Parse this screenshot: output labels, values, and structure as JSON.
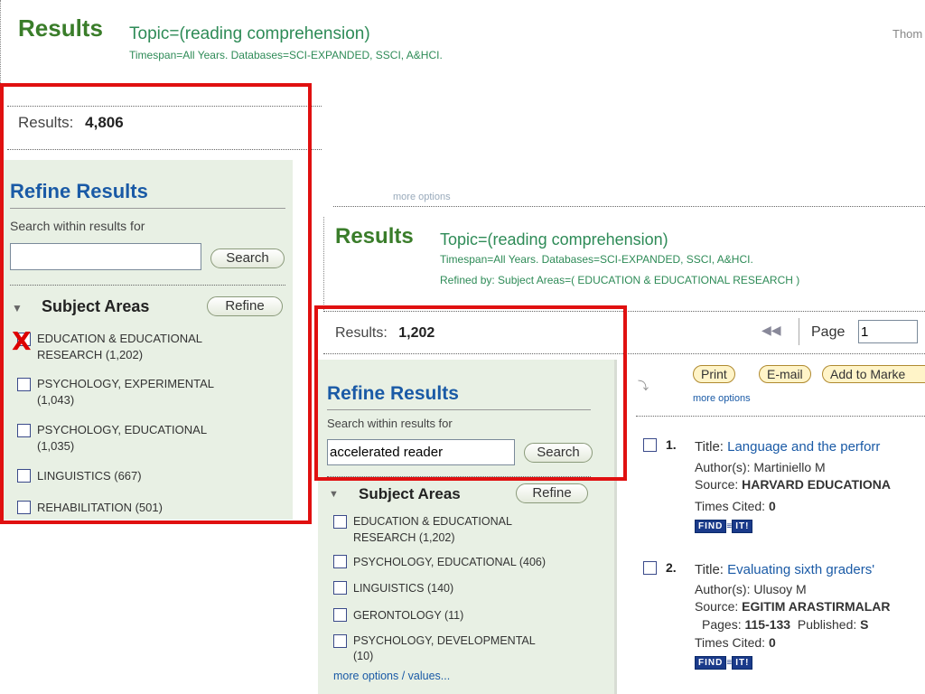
{
  "top": {
    "results_label": "Results",
    "topic": "Topic=(reading comprehension)",
    "timespan": "Timespan=All Years. Databases=SCI-EXPANDED, SSCI, A&HCI.",
    "corner": "Thom Sc"
  },
  "left_panel": {
    "results_label": "Results:",
    "results_count": "4,806",
    "refine_title": "Refine Results",
    "search_label": "Search within results for",
    "search_value": "",
    "search_button": "Search",
    "subject_header": "Subject Areas",
    "refine_button": "Refine",
    "items": [
      {
        "line1": "EDUCATION & EDUCATIONAL",
        "line2": "RESEARCH (1,202)"
      },
      {
        "line1": "PSYCHOLOGY, EXPERIMENTAL",
        "line2": "(1,043)"
      },
      {
        "line1": "PSYCHOLOGY, EDUCATIONAL",
        "line2": "(1,035)"
      },
      {
        "line1": "LINGUISTICS (667)",
        "line2": ""
      },
      {
        "line1": "REHABILITATION (501)",
        "line2": ""
      }
    ],
    "x_mark": "X"
  },
  "right_top": {
    "faded_text": "more options",
    "results_label": "Results",
    "topic": "Topic=(reading comprehension)",
    "timespan": "Timespan=All Years. Databases=SCI-EXPANDED, SSCI, A&HCI.",
    "refined_by": "Refined by: Subject Areas=( EDUCATION & EDUCATIONAL RESEARCH )"
  },
  "right_panel": {
    "results_label": "Results:",
    "results_count": "1,202",
    "page_label": "Page",
    "page_value": "1",
    "refine_title": "Refine Results",
    "search_label": "Search within results for",
    "search_value": "accelerated reader",
    "search_button": "Search",
    "subject_header": "Subject Areas",
    "refine_button": "Refine",
    "items": [
      {
        "line1": "EDUCATION & EDUCATIONAL",
        "line2": "RESEARCH (1,202)"
      },
      {
        "line1": "PSYCHOLOGY, EDUCATIONAL (406)",
        "line2": ""
      },
      {
        "line1": "LINGUISTICS (140)",
        "line2": ""
      },
      {
        "line1": "GERONTOLOGY (11)",
        "line2": ""
      },
      {
        "line1": "PSYCHOLOGY, DEVELOPMENTAL",
        "line2": "(10)"
      }
    ],
    "more_values": "more options / values..."
  },
  "actions": {
    "print": "Print",
    "email": "E-mail",
    "add_marked": "Add to Marke",
    "more_options": "more options"
  },
  "records": [
    {
      "num": "1.",
      "title_label": "Title:",
      "title": "Language and the perforr",
      "author_label": "Author(s):",
      "author": "Martiniello M",
      "source_label": "Source:",
      "source": "HARVARD EDUCATIONA",
      "pages_line": "",
      "cited_label": "Times Cited:",
      "cited": "0"
    },
    {
      "num": "2.",
      "title_label": "Title:",
      "title": "Evaluating sixth graders'",
      "author_label": "Author(s):",
      "author": "Ulusoy M",
      "source_label": "Source:",
      "source": "EGITIM ARASTIRMALAR",
      "pages_label": "Pages:",
      "pages": "115-133",
      "published_label": "Published:",
      "published": "S",
      "cited_label": "Times Cited:",
      "cited": "0"
    }
  ],
  "find_it": {
    "find": "FIND",
    "it": "IT!"
  }
}
